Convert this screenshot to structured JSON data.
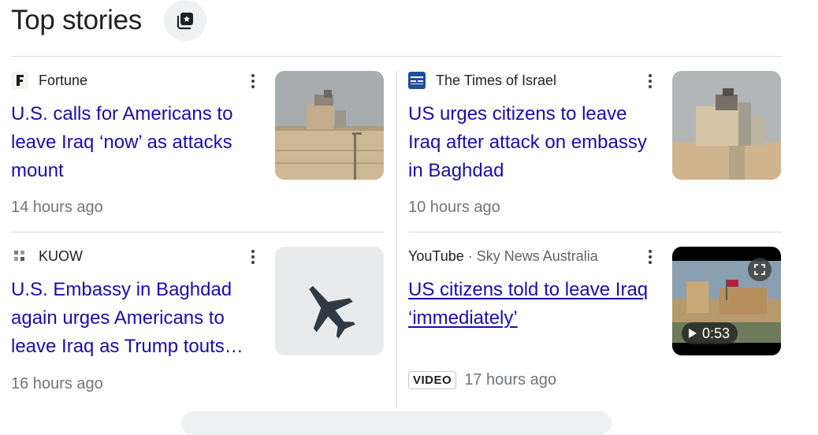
{
  "header": {
    "title": "Top stories",
    "action_icon": "full-coverage-icon"
  },
  "colors": {
    "link": "#1a0dab",
    "meta": "#70757a",
    "divider": "#dadce0"
  },
  "stories": [
    {
      "source": "Fortune",
      "source_icon": "fortune-logo-icon",
      "headline": "U.S. calls for Americans to leave Iraq ‘now’ as attacks mount",
      "time": "14 hours ago"
    },
    {
      "source": "The Times of Israel",
      "source_icon": "times-of-israel-logo-icon",
      "headline": "US urges citizens to leave Iraq after attack on embassy in Baghdad",
      "time": "10 hours ago"
    },
    {
      "source": "KUOW",
      "source_icon": "kuow-logo-icon",
      "headline": "U.S. Embassy in Baghdad again urges Americans to leave Iraq as Trump touts…",
      "time": "16 hours ago"
    },
    {
      "source": "YouTube",
      "source_sep": "·",
      "channel": "Sky News Australia",
      "source_icon": "youtube-icon",
      "headline": "US citizens told to leave Iraq ‘immediately’",
      "badge": "VIDEO",
      "duration": "0:53",
      "time": "17 hours ago"
    }
  ]
}
